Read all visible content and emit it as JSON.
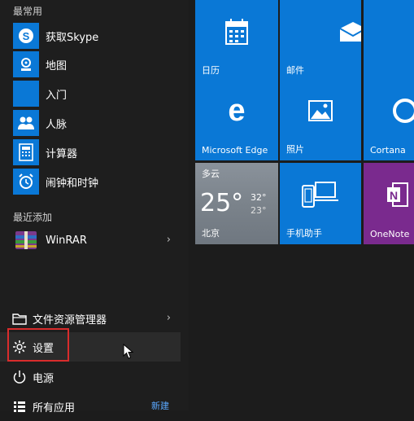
{
  "left": {
    "most_used_title": "最常用",
    "most_used": [
      {
        "label": "获取Skype",
        "icon": "skype-icon"
      },
      {
        "label": "地图",
        "icon": "maps-icon"
      },
      {
        "label": "入门",
        "icon": "getstarted-icon"
      },
      {
        "label": "人脉",
        "icon": "people-icon"
      },
      {
        "label": "计算器",
        "icon": "calculator-icon"
      },
      {
        "label": "闹钟和时钟",
        "icon": "alarm-icon"
      }
    ],
    "recent_title": "最近添加",
    "recent": [
      {
        "label": "WinRAR",
        "icon": "winrar-icon"
      }
    ],
    "system": {
      "file_explorer": "文件资源管理器",
      "settings": "设置",
      "power": "电源",
      "all_apps": "所有应用",
      "new_badge": "新建"
    }
  },
  "tiles": {
    "calendar": {
      "label": "日历",
      "color": "#0a78d6"
    },
    "mail": {
      "label": "邮件",
      "color": "#0a78d6"
    },
    "edge": {
      "label": "Microsoft Edge",
      "color": "#0a78d6"
    },
    "photos": {
      "label": "照片",
      "color": "#0a78d6"
    },
    "cortana": {
      "label": "Cortana",
      "color": "#0a78d6"
    },
    "weather": {
      "condition": "多云",
      "temp": "25°",
      "high": "32°",
      "low": "23°",
      "city": "北京"
    },
    "phone": {
      "label": "手机助手",
      "color": "#0a78d6"
    },
    "onenote": {
      "label": "OneNote",
      "color": "#7a2a8e"
    }
  }
}
